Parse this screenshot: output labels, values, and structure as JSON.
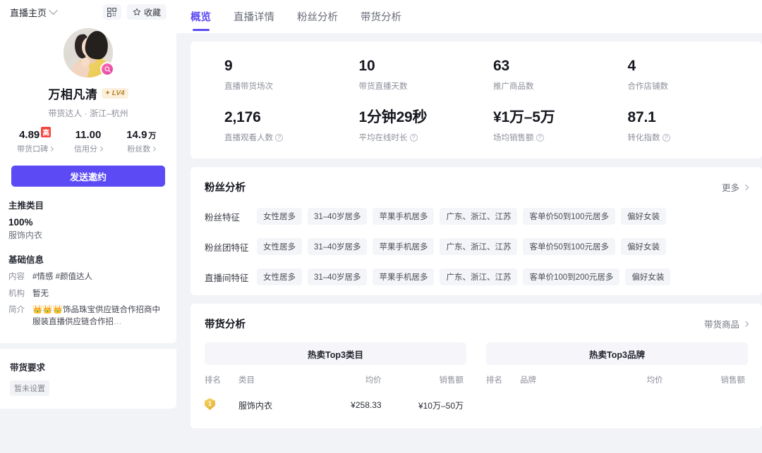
{
  "sidebar": {
    "home_label": "直播主页",
    "qr_icon": "qr-code-icon",
    "favorite_label": "收藏",
    "avatar_badge_icon": "live-search-icon",
    "name": "万相凡清",
    "level_badge": "LV4",
    "level_spark": "✦",
    "subtitle": "带货达人 · 浙江–杭州",
    "stats": [
      {
        "value": "4.89",
        "sup": "高",
        "unit": "",
        "label": "带货口碑"
      },
      {
        "value": "11.00",
        "sup": "",
        "unit": "",
        "label": "信用分"
      },
      {
        "value": "14.9",
        "sup": "",
        "unit": "万",
        "label": "粉丝数"
      }
    ],
    "invite_button": "发送邀约",
    "category_title": "主推类目",
    "category_percent": "100%",
    "category_name": "服饰内衣",
    "basic_title": "基础信息",
    "basic_info": [
      {
        "key": "内容",
        "value": "#情感  #颜值达人"
      },
      {
        "key": "机构",
        "value": "暂无"
      },
      {
        "key": "简介",
        "value": "👑👑👑饰品珠宝供应链合作招商中服装直播供应链合作招",
        "ellipsis": "…"
      }
    ],
    "requirement_title": "带货要求",
    "requirement_value": "暂未设置"
  },
  "tabs": [
    {
      "label": "概览",
      "active": true
    },
    {
      "label": "直播详情",
      "active": false
    },
    {
      "label": "粉丝分析",
      "active": false
    },
    {
      "label": "带货分析",
      "active": false
    }
  ],
  "kpis": [
    {
      "value": "9",
      "suffix": "",
      "label": "直播带货场次",
      "help": false
    },
    {
      "value": "10",
      "suffix": "",
      "label": "带货直播天数",
      "help": false
    },
    {
      "value": "63",
      "suffix": "",
      "label": "推广商品数",
      "help": false
    },
    {
      "value": "4",
      "suffix": "",
      "label": "合作店铺数",
      "help": false
    },
    {
      "value": "2,176",
      "suffix": "",
      "label": "直播观看人数",
      "help": true
    },
    {
      "value": "1分钟29秒",
      "suffix": "",
      "label": "平均在线时长",
      "help": true
    },
    {
      "value": "¥1万–5万",
      "suffix": "",
      "label": "场均销售额",
      "help": true
    },
    {
      "value": "87.1",
      "suffix": "",
      "label": "转化指数",
      "help": true
    }
  ],
  "fan_section": {
    "title": "粉丝分析",
    "more_label": "更多",
    "rows": [
      {
        "label": "粉丝特征",
        "chips": [
          "女性居多",
          "31–40岁居多",
          "苹果手机居多",
          "广东、浙江、江苏",
          "客单价50到100元居多",
          "偏好女装"
        ]
      },
      {
        "label": "粉丝团特征",
        "chips": [
          "女性居多",
          "31–40岁居多",
          "苹果手机居多",
          "广东、浙江、江苏",
          "客单价50到100元居多",
          "偏好女装"
        ]
      },
      {
        "label": "直播间特征",
        "chips": [
          "女性居多",
          "31–40岁居多",
          "苹果手机居多",
          "广东、浙江、江苏",
          "客单价100到200元居多",
          "偏好女装"
        ]
      }
    ]
  },
  "goods_section": {
    "title": "带货分析",
    "more_label": "带货商品",
    "tables": [
      {
        "banner": "热卖Top3类目",
        "headers": [
          "排名",
          "类目",
          "均价",
          "销售额"
        ],
        "rows": [
          {
            "rank": "1",
            "name": "服饰内衣",
            "price": "¥258.33",
            "sales": "¥10万–50万"
          }
        ]
      },
      {
        "banner": "热卖Top3品牌",
        "headers": [
          "排名",
          "品牌",
          "均价",
          "销售额"
        ],
        "rows": []
      }
    ]
  },
  "colors": {
    "accent": "#5c4bf4",
    "page_bg": "#f2f3f7",
    "chip_bg": "#f4f5f8",
    "badge_red": "#f5453f",
    "level_gold": "#b8862f",
    "medal_gold": "#e0ae2e"
  }
}
